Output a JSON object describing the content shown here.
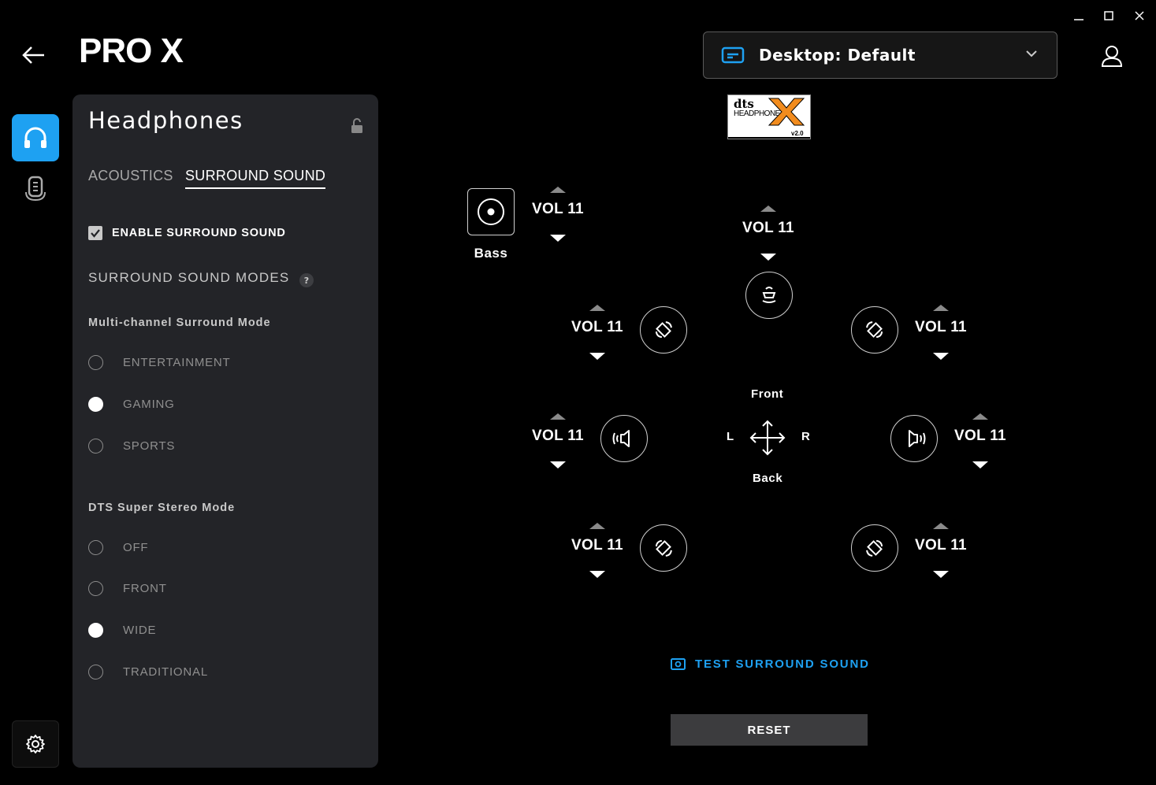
{
  "header": {
    "product": "PRO X",
    "profile": "Desktop: Default"
  },
  "panel": {
    "title": "Headphones",
    "tabs": [
      "ACOUSTICS",
      "SURROUND SOUND"
    ],
    "active_tab": "SURROUND SOUND",
    "enable_label": "ENABLE SURROUND SOUND",
    "enable_checked": true,
    "modes_heading": "SURROUND SOUND MODES",
    "help": "?",
    "multichannel": {
      "heading": "Multi-channel Surround Mode",
      "options": [
        "ENTERTAINMENT",
        "GAMING",
        "SPORTS"
      ],
      "selected": "GAMING"
    },
    "stereo": {
      "heading": "DTS Super Stereo Mode",
      "options": [
        "OFF",
        "FRONT",
        "WIDE",
        "TRADITIONAL"
      ],
      "selected": "WIDE"
    }
  },
  "dts_logo": {
    "line1": "dts",
    "line2": "HEADPHONE",
    "version": "v2.0"
  },
  "speakers": {
    "bass": {
      "label": "Bass",
      "volume": "VOL 11"
    },
    "center": {
      "volume": "VOL 11"
    },
    "front_left": {
      "volume": "VOL 11"
    },
    "front_right": {
      "volume": "VOL 11"
    },
    "side_left": {
      "volume": "VOL 11"
    },
    "side_right": {
      "volume": "VOL 11"
    },
    "rear_left": {
      "volume": "VOL 11"
    },
    "rear_right": {
      "volume": "VOL 11"
    }
  },
  "directions": {
    "front": "Front",
    "back": "Back",
    "left": "L",
    "right": "R"
  },
  "actions": {
    "test": "TEST SURROUND SOUND",
    "reset": "RESET"
  },
  "colors": {
    "accent": "#1ea1f2",
    "panel": "#232428",
    "background": "#000000"
  }
}
